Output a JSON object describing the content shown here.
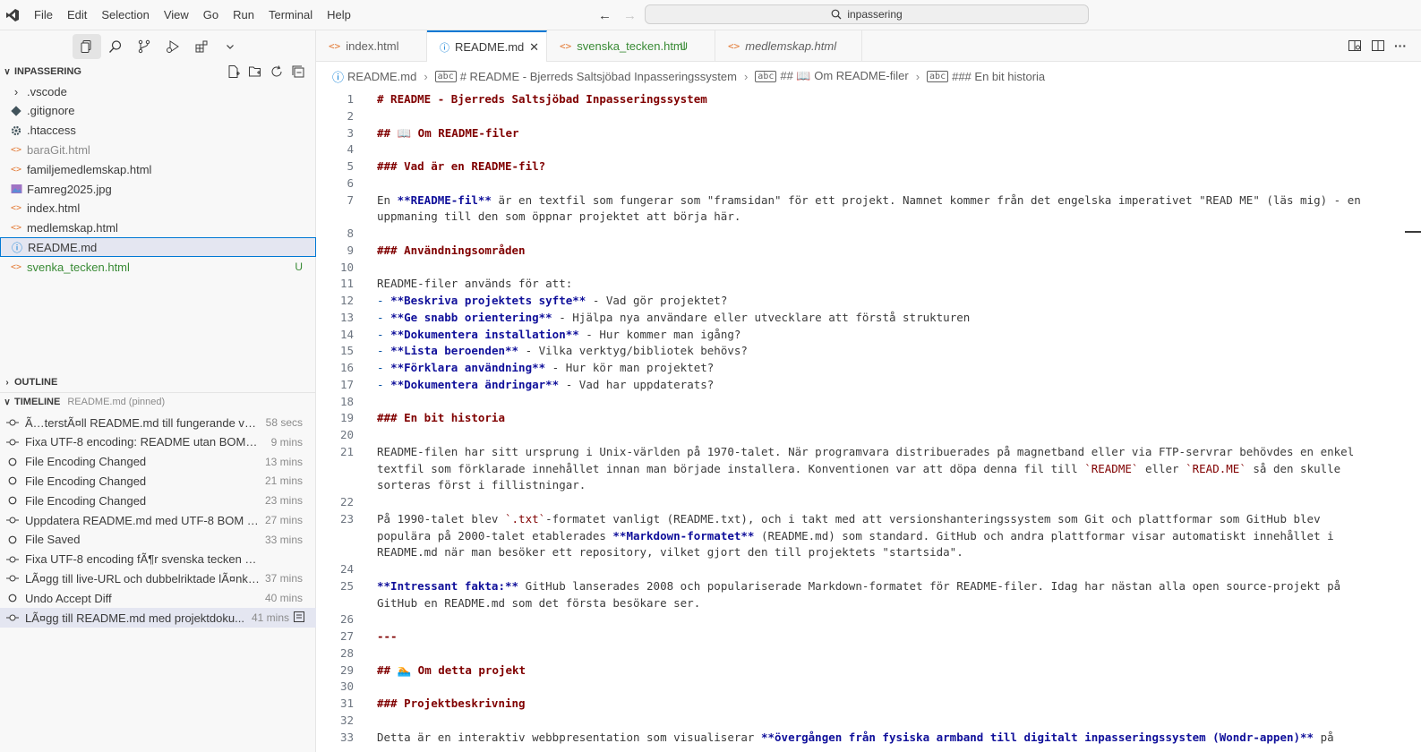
{
  "menu": [
    "File",
    "Edit",
    "Selection",
    "View",
    "Go",
    "Run",
    "Terminal",
    "Help"
  ],
  "search": {
    "text": "inpassering"
  },
  "sidebar": {
    "explorer_title": "INPASSERING",
    "files": [
      {
        "name": ".vscode",
        "icon": "chevron-right-icon"
      },
      {
        "name": ".gitignore",
        "icon": "git-icon"
      },
      {
        "name": ".htaccess",
        "icon": "gear-icon"
      },
      {
        "name": "baraGit.html",
        "icon": "html-icon"
      },
      {
        "name": "familjemedlemskap.html",
        "icon": "html-icon"
      },
      {
        "name": "Famreg2025.jpg",
        "icon": "image-icon"
      },
      {
        "name": "index.html",
        "icon": "html-icon"
      },
      {
        "name": "medlemskap.html",
        "icon": "html-icon"
      },
      {
        "name": "README.md",
        "icon": "info-icon"
      },
      {
        "name": "svenka_tecken.html",
        "icon": "html-icon",
        "badge": "U"
      }
    ],
    "outline_title": "OUTLINE",
    "timeline_title": "TIMELINE",
    "timeline_subtitle": "README.md (pinned)",
    "timeline": [
      {
        "label": "Ã…terstÃ¤ll README.md till fungerande versi...",
        "time": "58 secs",
        "icon": "commit-icon"
      },
      {
        "label": "Fixa UTF-8 encoding: README utan BOM + .h...",
        "time": "9 mins",
        "icon": "commit-icon"
      },
      {
        "label": "File Encoding Changed",
        "time": "13 mins",
        "icon": "circle-icon"
      },
      {
        "label": "File Encoding Changed",
        "time": "21 mins",
        "icon": "circle-icon"
      },
      {
        "label": "File Encoding Changed",
        "time": "23 mins",
        "icon": "circle-icon"
      },
      {
        "label": "Uppdatera README.md med UTF-8 BOM en...",
        "time": "27 mins",
        "icon": "commit-icon"
      },
      {
        "label": "File Saved",
        "time": "33 mins",
        "icon": "circle-icon"
      },
      {
        "label": "Fixa UTF-8 encoding fÃ¶r svenska tecken (Ã¥, Ã¤, ...",
        "time": "",
        "icon": "commit-icon"
      },
      {
        "label": "LÃ¤gg till live-URL och dubbelriktade lÃ¤nka...",
        "time": "37 mins",
        "icon": "commit-icon"
      },
      {
        "label": "Undo Accept Diff",
        "time": "40 mins",
        "icon": "circle-icon"
      },
      {
        "label": "LÃ¤gg till README.md med projektdoku...",
        "time": "41 mins",
        "icon": "commit-icon"
      }
    ]
  },
  "tabs": [
    {
      "label": "index.html",
      "italic": false
    },
    {
      "label": "README.md",
      "active": true
    },
    {
      "label": "svenska_tecken.html",
      "badge": "U"
    },
    {
      "label": "medlemskap.html",
      "italic": true
    }
  ],
  "breadcrumb": [
    "README.md",
    "# README - Bjerreds Saltsjöbad Inpasseringssystem",
    "## 📖 Om README-filer",
    "### En bit historia"
  ],
  "editor": {
    "lines": [
      {
        "n": "1",
        "t": "# README - Bjerreds Saltsjöbad Inpasseringssystem"
      },
      {
        "n": "2",
        "t": ""
      },
      {
        "n": "3",
        "t": "## 📖 Om README-filer"
      },
      {
        "n": "4",
        "t": ""
      },
      {
        "n": "5",
        "t": "### Vad är en README-fil?"
      },
      {
        "n": "6",
        "t": ""
      },
      {
        "n": "7",
        "t": "En **README-fil** är en textfil som fungerar som \"framsidan\" för ett projekt. Namnet kommer från det engelska imperativet \"READ ME\" (läs mig) - en"
      },
      {
        "n": "",
        "t": "uppmaning till den som öppnar projektet att börja här."
      },
      {
        "n": "8",
        "t": ""
      },
      {
        "n": "9",
        "t": "### Användningsområden"
      },
      {
        "n": "10",
        "t": ""
      },
      {
        "n": "11",
        "t": "README-filer används för att:"
      },
      {
        "n": "12",
        "t": "- **Beskriva projektets syfte** - Vad gör projektet?"
      },
      {
        "n": "13",
        "t": "- **Ge snabb orientering** - Hjälpa nya användare eller utvecklare att förstå strukturen"
      },
      {
        "n": "14",
        "t": "- **Dokumentera installation** - Hur kommer man igång?"
      },
      {
        "n": "15",
        "t": "- **Lista beroenden** - Vilka verktyg/bibliotek behövs?"
      },
      {
        "n": "16",
        "t": "- **Förklara användning** - Hur kör man projektet?"
      },
      {
        "n": "17",
        "t": "- **Dokumentera ändringar** - Vad har uppdaterats?"
      },
      {
        "n": "18",
        "t": ""
      },
      {
        "n": "19",
        "t": "### En bit historia"
      },
      {
        "n": "20",
        "t": ""
      },
      {
        "n": "21",
        "t": "README-filen har sitt ursprung i Unix-världen på 1970-talet. När programvara distribuerades på magnetband eller via FTP-servrar behövdes en enkel"
      },
      {
        "n": "",
        "t": "textfil som förklarade innehållet innan man började installera. Konventionen var att döpa denna fil till `README` eller `READ.ME` så den skulle"
      },
      {
        "n": "",
        "t": "sorteras först i fillistningar."
      },
      {
        "n": "22",
        "t": ""
      },
      {
        "n": "23",
        "t": "På 1990-talet blev `.txt`-formatet vanligt (README.txt), och i takt med att versionshanteringssystem som Git och plattformar som GitHub blev"
      },
      {
        "n": "",
        "t": "populära på 2000-talet etablerades **Markdown-formatet** (README.md) som standard. GitHub och andra plattformar visar automatiskt innehållet i"
      },
      {
        "n": "",
        "t": "README.md när man besöker ett repository, vilket gjort den till projektets \"startsida\"."
      },
      {
        "n": "24",
        "t": ""
      },
      {
        "n": "25",
        "t": "**Intressant fakta:** GitHub lanserades 2008 och populariserade Markdown-formatet för README-filer. Idag har nästan alla open source-projekt på"
      },
      {
        "n": "",
        "t": "GitHub en README.md som det första besökare ser."
      },
      {
        "n": "26",
        "t": ""
      },
      {
        "n": "27",
        "t": "---"
      },
      {
        "n": "28",
        "t": ""
      },
      {
        "n": "29",
        "t": "## 🏊 Om detta projekt"
      },
      {
        "n": "30",
        "t": ""
      },
      {
        "n": "31",
        "t": "### Projektbeskrivning"
      },
      {
        "n": "32",
        "t": ""
      },
      {
        "n": "33",
        "t": "Detta är en interaktiv webbpresentation som visualiserar **övergången från fysiska armband till digitalt inpasseringssystem (Wondr-appen)** på"
      }
    ]
  }
}
